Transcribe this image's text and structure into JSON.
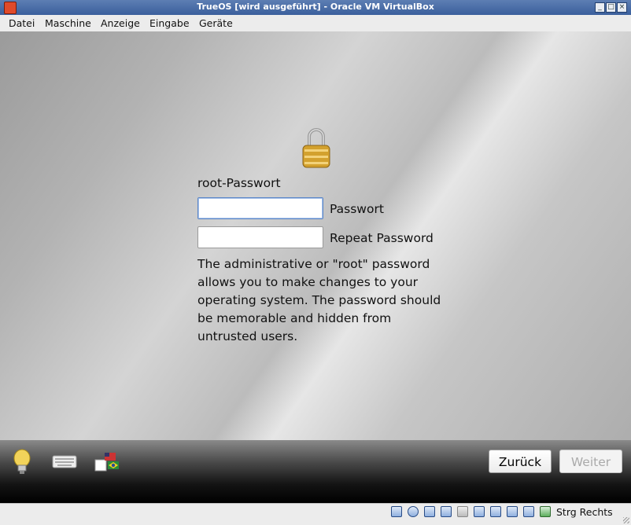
{
  "window": {
    "title": "TrueOS [wird ausgeführt] - Oracle VM VirtualBox",
    "minimize_label": "_",
    "maximize_label": "□",
    "close_label": "×"
  },
  "menu": [
    "Datei",
    "Maschine",
    "Anzeige",
    "Eingabe",
    "Geräte"
  ],
  "installer": {
    "heading": "root-Passwort",
    "password_label": "Passwort",
    "password_value": "",
    "repeat_label": "Repeat Password",
    "repeat_value": "",
    "description": "The administrative or \"root\" password allows you to make changes to your operating system. The password should be memorable and hidden from untrusted users.",
    "back_button": "Zurück",
    "next_button": "Weiter",
    "next_enabled": false,
    "bottom_icons": [
      "lightbulb-icon",
      "keyboard-icon",
      "language-flag-icon"
    ]
  },
  "statusbar": {
    "icons": [
      "hard-disk-icon",
      "optical-drive-icon",
      "network-icon",
      "usb-icon",
      "shared-folders-icon",
      "display-icon",
      "video-capture-icon",
      "virtualization-icon",
      "cpu-icon",
      "mouse-integration-icon",
      "host-key-arrow-icon"
    ],
    "host_key": "Strg Rechts"
  }
}
